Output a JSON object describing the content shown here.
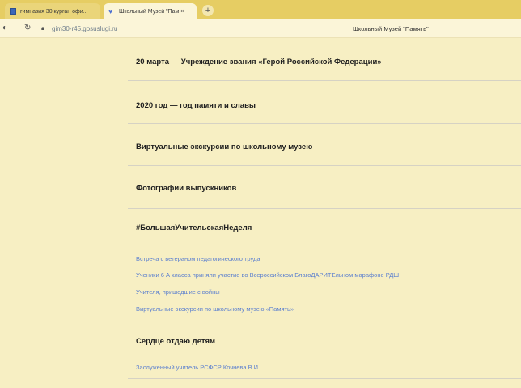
{
  "browser": {
    "tabs": [
      {
        "label": "гимназия 30 курган офи...",
        "active": false
      },
      {
        "label": "Школьный Музей \"Пам ×",
        "active": true
      }
    ],
    "new_tab": "+",
    "url": "gim30-r45.gosuslugi.ru",
    "page_title": "Школьный Музей \"Память\""
  },
  "page": {
    "sections": [
      {
        "title": "20 марта — Учреждение звания «Герой Российской Федерации»"
      },
      {
        "title": "2020 год — год памяти и славы"
      },
      {
        "title": "Виртуальные экскурсии по школьному музею"
      },
      {
        "title": "Фотографии выпускников"
      },
      {
        "title": "#БольшаяУчительскаяНеделя",
        "links": [
          "Встреча с ветераном педагогического труда",
          "Ученики 6 А класса приняли участие во Всероссийском БлагоДАРИТЕльном марафоне РДШ",
          "Учителя, пришедшие с войны",
          "Виртуальные экскурсии по школьному музею «Память»"
        ]
      },
      {
        "title": "Сердце отдаю детям",
        "links": [
          "Заслуженный учитель РСФСР Кочнева В.И."
        ]
      }
    ]
  },
  "colors": {
    "tab_strip": "#e6cd63",
    "page_background": "#f7efc3",
    "link": "#5b7fcf"
  }
}
